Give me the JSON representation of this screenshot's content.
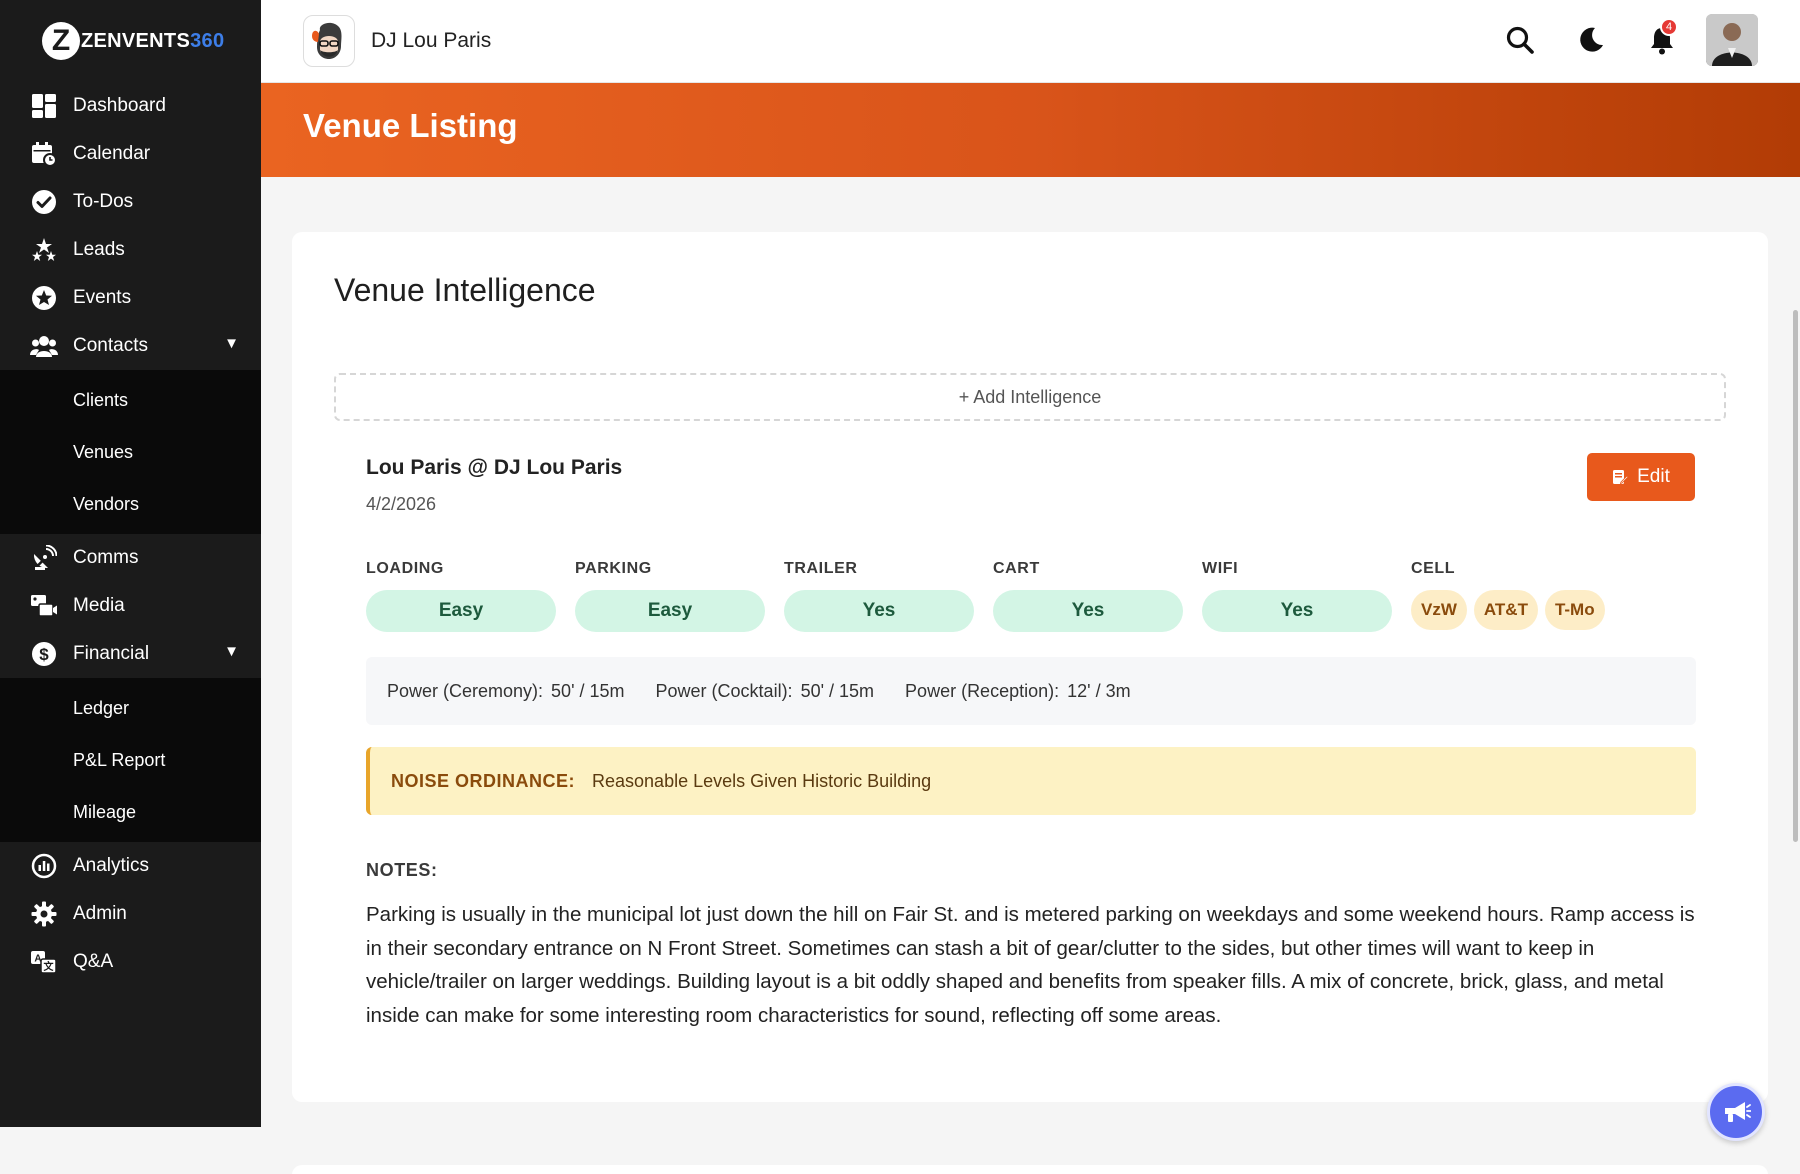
{
  "app": {
    "logo_letter": "Z",
    "logo_main": "ZENVENTS",
    "logo_accent": "360",
    "accent_color": "#3d7ee8"
  },
  "sidebar": {
    "items": [
      {
        "label": "Dashboard",
        "icon": "dashboard-icon"
      },
      {
        "label": "Calendar",
        "icon": "calendar-icon"
      },
      {
        "label": "To-Dos",
        "icon": "check-circle-icon"
      },
      {
        "label": "Leads",
        "icon": "stars-icon"
      },
      {
        "label": "Events",
        "icon": "star-circle-icon"
      },
      {
        "label": "Contacts",
        "icon": "users-icon",
        "expanded": true,
        "caret": "▼"
      },
      {
        "label": "Comms",
        "icon": "satellite-dish-icon"
      },
      {
        "label": "Media",
        "icon": "photo-video-icon"
      },
      {
        "label": "Financial",
        "icon": "dollar-circle-icon",
        "expanded": true,
        "caret": "▼"
      },
      {
        "label": "Analytics",
        "icon": "chart-gauge-icon"
      },
      {
        "label": "Admin",
        "icon": "gear-icon"
      },
      {
        "label": "Q&A",
        "icon": "language-icon"
      }
    ],
    "contacts_sub": [
      "Clients",
      "Venues",
      "Vendors"
    ],
    "financial_sub": [
      "Ledger",
      "P&L Report",
      "Mileage"
    ]
  },
  "topbar": {
    "business_name": "DJ Lou Paris",
    "notification_count": "4",
    "icons": [
      "search-icon",
      "moon-icon",
      "bell-icon"
    ]
  },
  "banner": {
    "title": "Venue Listing",
    "colors": [
      "#ea6421",
      "#b23c05"
    ]
  },
  "intel": {
    "title": "Venue Intelligence",
    "add_label": "+ Add Intelligence",
    "entry": {
      "author": "Lou Paris @ DJ Lou Paris",
      "date": "4/2/2026",
      "edit_label": "Edit",
      "attributes": [
        {
          "label": "LOADING",
          "value": "Easy"
        },
        {
          "label": "PARKING",
          "value": "Easy"
        },
        {
          "label": "TRAILER",
          "value": "Yes"
        },
        {
          "label": "CART",
          "value": "Yes"
        },
        {
          "label": "WIFI",
          "value": "Yes"
        }
      ],
      "cell": {
        "label": "CELL",
        "carriers": [
          "VzW",
          "AT&T",
          "T-Mo"
        ]
      },
      "power": [
        {
          "label": "Power (Ceremony):",
          "value": "50' / 15m"
        },
        {
          "label": "Power (Cocktail):",
          "value": "50' / 15m"
        },
        {
          "label": "Power (Reception):",
          "value": "12' / 3m"
        }
      ],
      "noise": {
        "label": "NOISE ORDINANCE:",
        "value": "Reasonable Levels Given Historic Building"
      },
      "notes_label": "NOTES:",
      "notes": "Parking is usually in the municipal lot just down the hill on Fair St. and is metered parking on weekdays and some weekend hours. Ramp access is in their secondary entrance on N Front Street. Sometimes can stash a bit of gear/clutter to the sides, but other times will want to keep in vehicle/trailer on larger weddings. Building layout is a bit oddly shaped and benefits from speaker fills. A mix of concrete, brick, glass, and metal inside can make for some interesting room characteristics for sound, reflecting off some areas."
    }
  },
  "fab": {
    "icon": "megaphone-icon"
  }
}
